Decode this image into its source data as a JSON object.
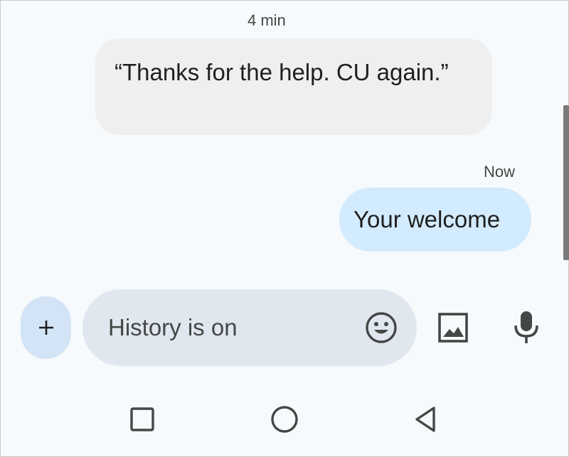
{
  "conversation": {
    "messages": [
      {
        "direction": "incoming",
        "timestamp": "4 min",
        "text": "“Thanks for the help. CU again.”"
      },
      {
        "direction": "outgoing",
        "timestamp": "Now",
        "text": "Your welcome"
      }
    ]
  },
  "composer": {
    "placeholder": "History is on",
    "value": "",
    "add_icon": "plus-icon",
    "emoji_icon": "emoji-icon",
    "image_icon": "image-icon",
    "mic_icon": "mic-icon"
  },
  "nav_bar": {
    "icons": [
      "recents-icon",
      "home-icon",
      "back-icon"
    ]
  },
  "colors": {
    "background": "#f7fafc",
    "incoming_bubble": "#efeff0",
    "outgoing_bubble": "#d3ebff",
    "compose_field": "#e1e7ef",
    "plus_button": "#d2e4f5",
    "icon": "#444746"
  }
}
